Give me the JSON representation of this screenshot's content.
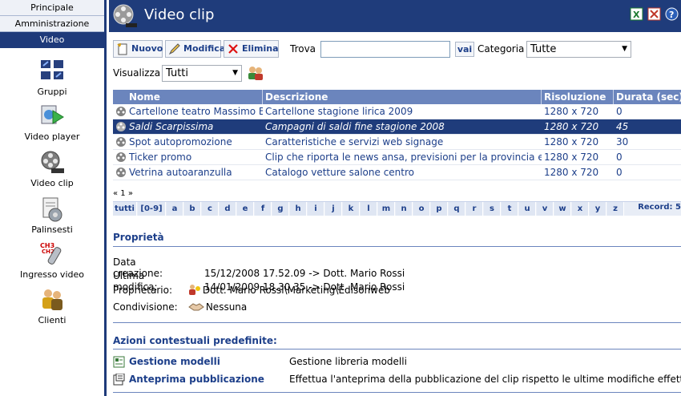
{
  "nav": {
    "tabs": [
      "Principale",
      "Amministrazione",
      "Video"
    ],
    "items": [
      {
        "label": "Gruppi",
        "icon": "groups-icon"
      },
      {
        "label": "Video player",
        "icon": "video-player-icon"
      },
      {
        "label": "Video clip",
        "icon": "film-reel-icon"
      },
      {
        "label": "Palinsesti",
        "icon": "schedule-icon"
      },
      {
        "label": "Ingresso video",
        "icon": "video-input-icon"
      },
      {
        "label": "Clienti",
        "icon": "clients-icon"
      }
    ]
  },
  "header": {
    "title": "Video clip",
    "accent": "#1f3c7b"
  },
  "toolbar": {
    "new_label": "Nuovo",
    "edit_label": "Modifica",
    "delete_label": "Elimina",
    "search_label": "Trova",
    "search_value": "",
    "go_label": "vai",
    "category_label": "Categoria",
    "category_value": "Tutte",
    "view_label": "Visualizza",
    "view_value": "Tutti"
  },
  "table": {
    "columns": [
      "Nome",
      "Descrizione",
      "Risoluzione",
      "Durata (sec)"
    ],
    "rows": [
      {
        "name": "Cartellone teatro Massimo Be",
        "desc": "Cartellone stagione lirica 2009",
        "res": "1280 x 720",
        "dur": "0"
      },
      {
        "name": "Saldi Scarpissima",
        "desc": "Campagni di saldi fine stagione 2008",
        "res": "1280 x 720",
        "dur": "45"
      },
      {
        "name": "Spot autopromozione",
        "desc": "Caratteristiche e servizi web signage",
        "res": "1280 x 720",
        "dur": "30"
      },
      {
        "name": "Ticker promo",
        "desc": "Clip che riporta le news ansa, previsioni per la provincia e lo",
        "res": "1280 x 720",
        "dur": "0"
      },
      {
        "name": "Vetrina autoaranzulla",
        "desc": "Catalogo vetture salone centro",
        "res": "1280 x 720",
        "dur": "0"
      }
    ],
    "pager": "« 1 »",
    "alpha": [
      "tutti",
      "[0-9]",
      "a",
      "b",
      "c",
      "d",
      "e",
      "f",
      "g",
      "h",
      "i",
      "j",
      "k",
      "l",
      "m",
      "n",
      "o",
      "p",
      "q",
      "r",
      "s",
      "t",
      "u",
      "v",
      "w",
      "x",
      "y",
      "z"
    ],
    "record_label": "Record: 5"
  },
  "props": {
    "title": "Proprietà",
    "created_label": "Data creazione:",
    "created_value": "15/12/2008 17.52.09 -> Dott. Mario Rossi",
    "modified_label": "Ultima modifica:",
    "modified_value": "14/01/2009 18.30.35 -> Dott. Mario Rossi",
    "owner_label": "Proprietario:",
    "owner_value": "Dott. Mario Rossi\\Marketing\\Edisonweb",
    "share_label": "Condivisione:",
    "share_value": "Nessuna"
  },
  "actions": {
    "title": "Azioni contestuali predefinite:",
    "items": [
      {
        "label": "Gestione modelli",
        "desc": "Gestione libreria modelli"
      },
      {
        "label": "Anteprima pubblicazione",
        "desc": "Effettua l'anteprima della pubblicazione del clip rispetto le ultime modifiche effettuate"
      }
    ]
  }
}
